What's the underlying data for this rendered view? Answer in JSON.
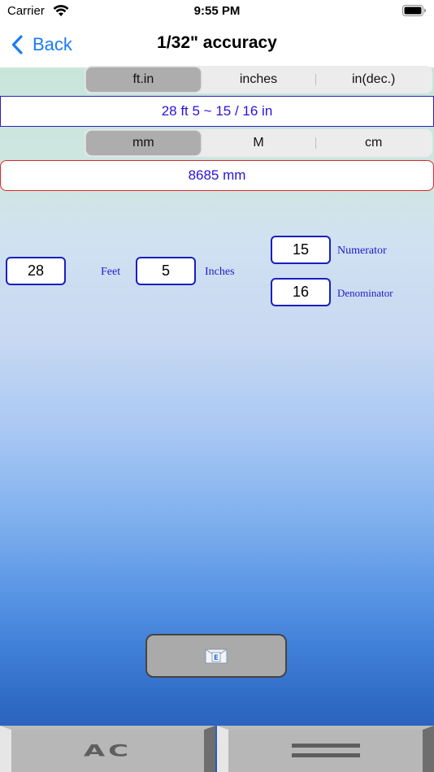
{
  "status": {
    "carrier": "Carrier",
    "time": "9:55 PM"
  },
  "nav": {
    "back_label": "Back",
    "title": "1/32\" accuracy"
  },
  "imperial_units": {
    "options": [
      "ft.in",
      "inches",
      "in(dec.)"
    ],
    "selected": "ft.in"
  },
  "imperial_result": "28 ft 5 ~ 15 / 16 in",
  "metric_units": {
    "options": [
      "mm",
      "M",
      "cm"
    ],
    "selected": "mm"
  },
  "metric_result": "8685 mm",
  "inputs": {
    "feet": {
      "value": "28",
      "label": "Feet"
    },
    "inches": {
      "value": "5",
      "label": "Inches"
    },
    "numerator": {
      "value": "15",
      "label": "Numerator"
    },
    "denominator": {
      "value": "16",
      "label": "Denominator"
    }
  },
  "buttons": {
    "clear_label": "AC"
  },
  "colors": {
    "accent": "#1b7cf2",
    "result_text": "#2a13d6",
    "field_border": "#1a1fbf",
    "metric_border": "#e0242a"
  }
}
